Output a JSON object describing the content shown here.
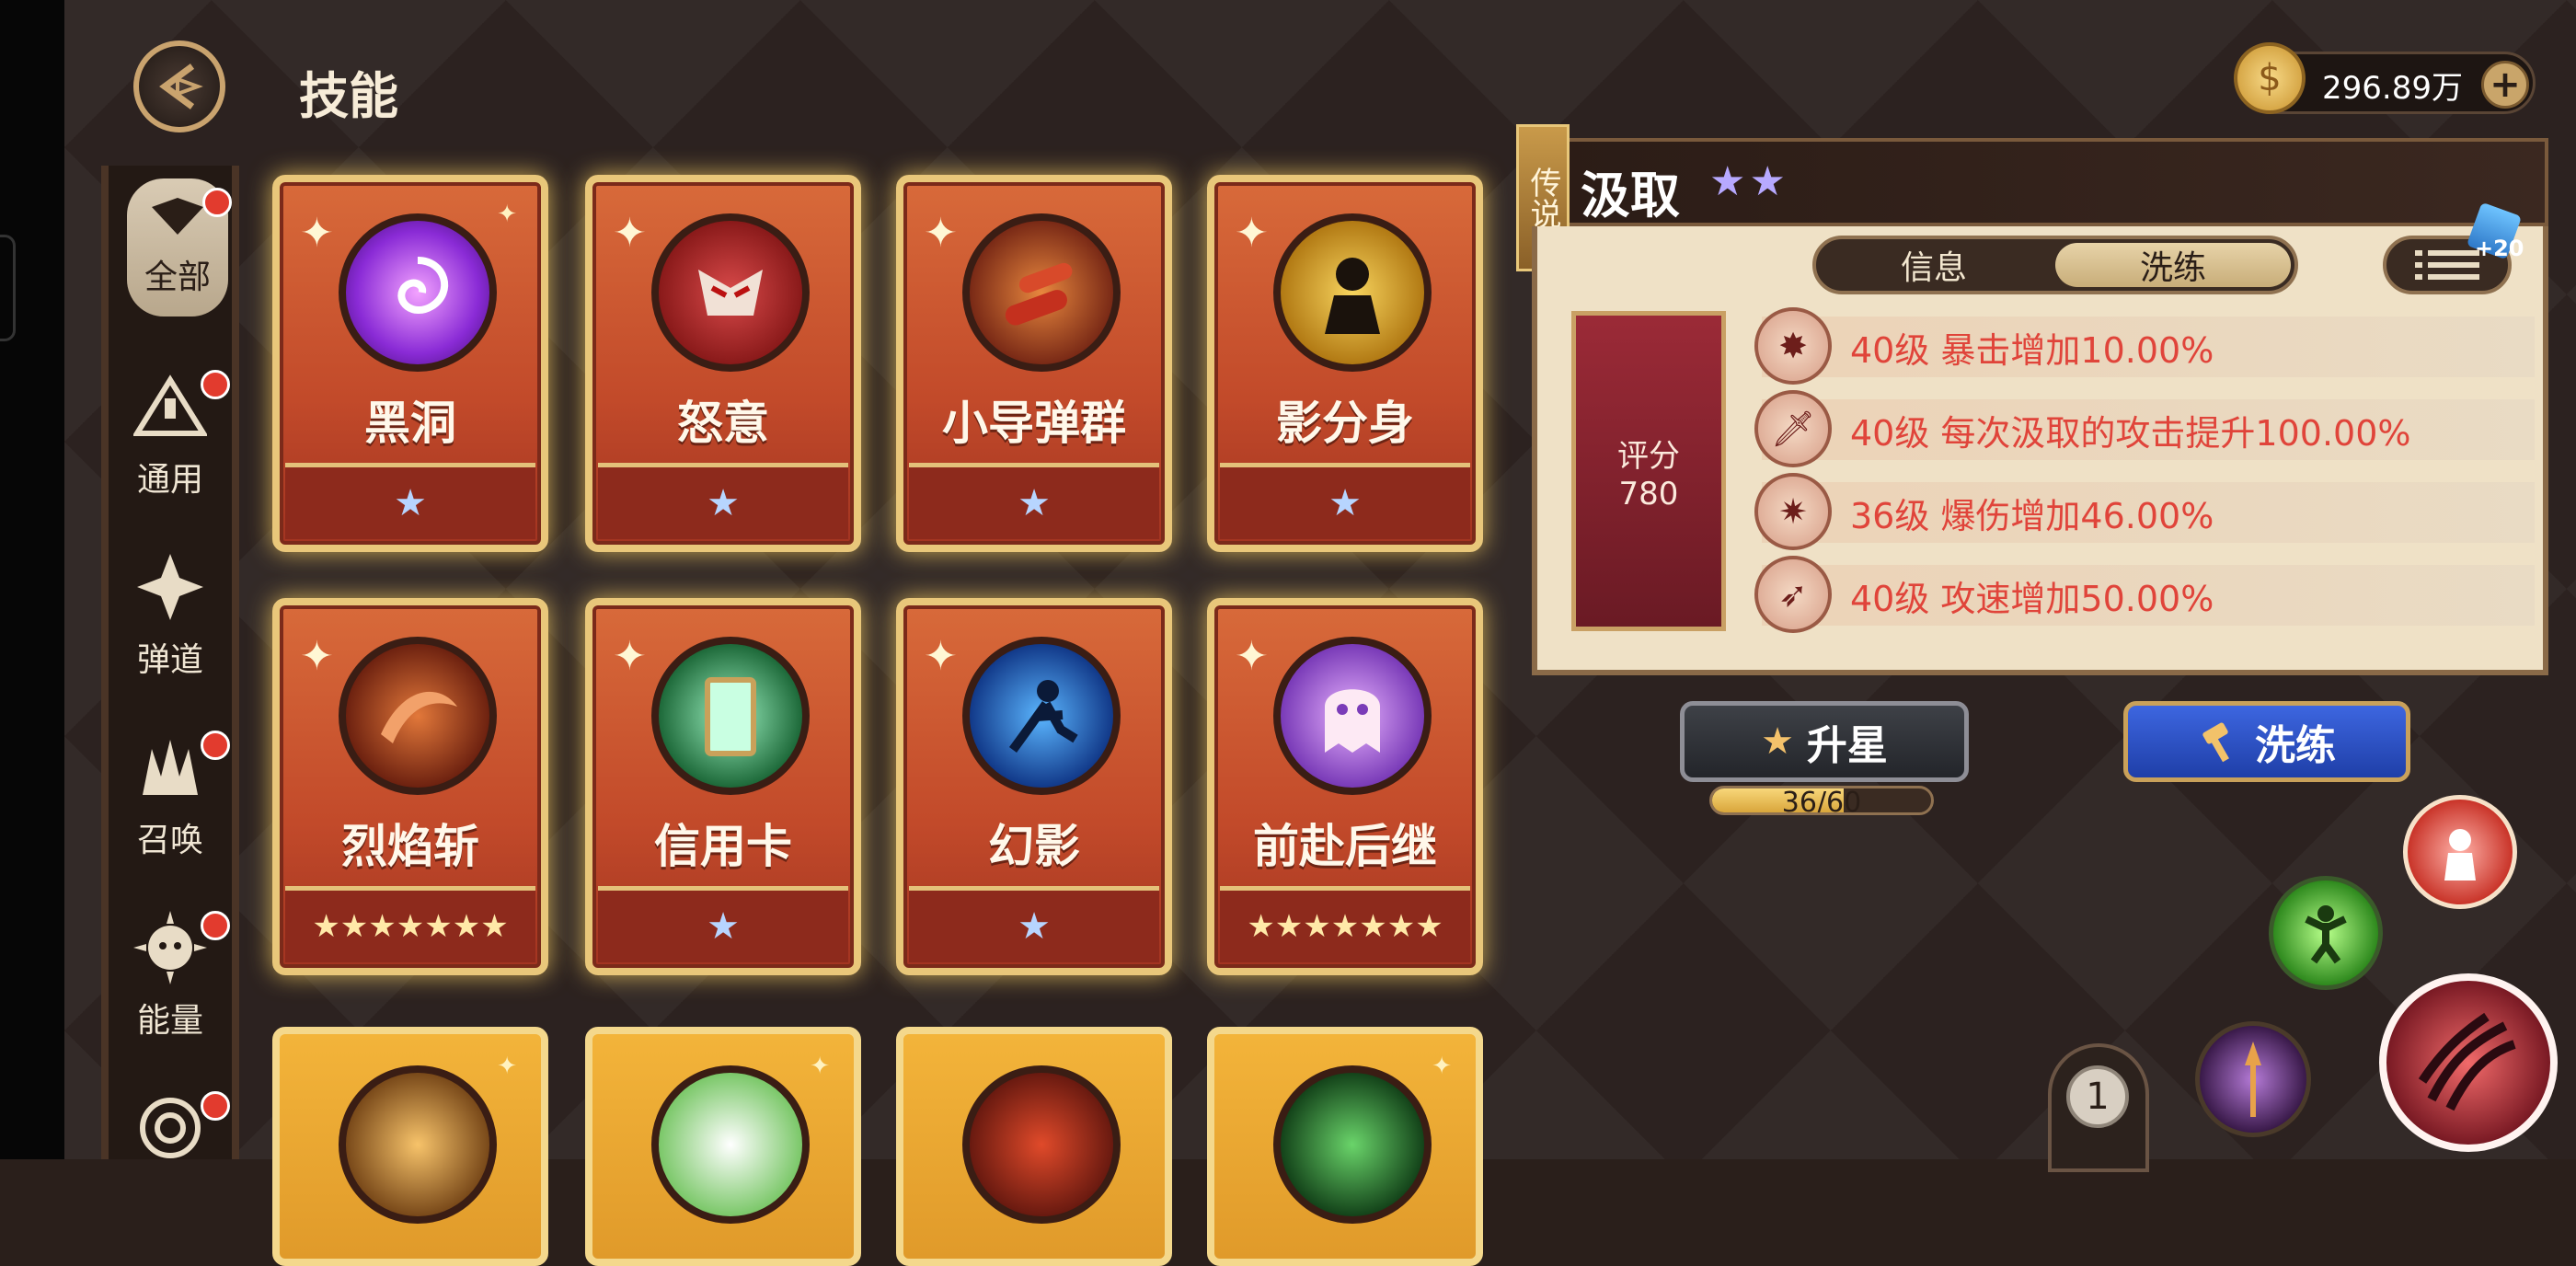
{
  "header": {
    "title": "技能"
  },
  "currency": {
    "amount": "296.89万",
    "plus": "+"
  },
  "sidebar": {
    "items": [
      {
        "label": "全部",
        "icon": "all-icon",
        "active": true,
        "badge": true
      },
      {
        "label": "通用",
        "icon": "general-icon",
        "badge": true
      },
      {
        "label": "弹道",
        "icon": "trajectory-icon",
        "badge": false
      },
      {
        "label": "召唤",
        "icon": "summon-icon",
        "badge": true
      },
      {
        "label": "能量",
        "icon": "energy-icon",
        "badge": true
      },
      {
        "label": "",
        "icon": "swirl-icon",
        "badge": true
      }
    ]
  },
  "cards": [
    {
      "name": "黑洞",
      "stars": "★"
    },
    {
      "name": "怒意",
      "stars": "★"
    },
    {
      "name": "小导弹群",
      "stars": "★"
    },
    {
      "name": "影分身",
      "stars": "★"
    },
    {
      "name": "烈焰斩",
      "stars": "★★★★★★★"
    },
    {
      "name": "信用卡",
      "stars": "★"
    },
    {
      "name": "幻影",
      "stars": "★"
    },
    {
      "name": "前赴后继",
      "stars": "★★★★★★★"
    }
  ],
  "detail": {
    "rarity_tag": "传说",
    "name": "汲取",
    "stars": "★★",
    "tabs": [
      {
        "label": "信息"
      },
      {
        "label": "洗练"
      }
    ],
    "gem_count": "+20",
    "score_label": "评分",
    "score_value": "780",
    "attributes": [
      {
        "text": "40级 暴击增加10.00%"
      },
      {
        "text": "40级 每次汲取的攻击提升100.00%"
      },
      {
        "text": "36级 爆伤增加46.00%"
      },
      {
        "text": "40级 攻速增加50.00%"
      }
    ]
  },
  "actions": {
    "upgrade_label": "升星",
    "progress_text": "36/60",
    "progress_current": 36,
    "progress_max": 60,
    "refine_label": "洗练"
  },
  "page_indicator": "1",
  "colors": {
    "accent_red": "#e0443a",
    "card_orange": "#d86a3a",
    "gold": "#e9c77a",
    "refine_blue": "#3d66e0"
  }
}
